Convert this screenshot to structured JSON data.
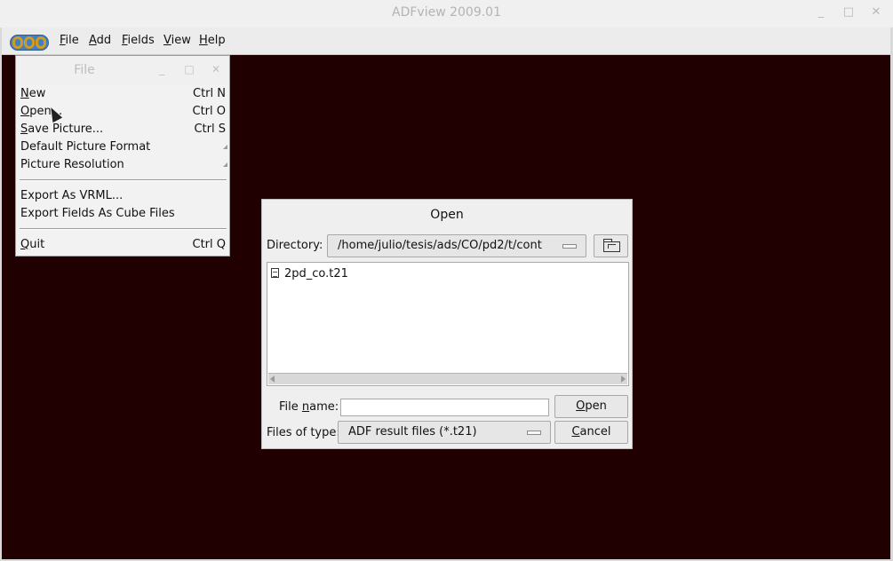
{
  "window": {
    "title": "ADFview 2009.01",
    "controls": {
      "minimize": "_",
      "maximize": "□",
      "close": "✕"
    }
  },
  "menubar": {
    "logo": "sch-logo",
    "items": [
      {
        "label": "File",
        "mnemonic": "F",
        "rest": "ile"
      },
      {
        "label": "Add",
        "mnemonic": "A",
        "rest": "dd"
      },
      {
        "label": "Fields",
        "mnemonic": "F",
        "rest": "ields"
      },
      {
        "label": "View",
        "mnemonic": "V",
        "rest": "iew"
      },
      {
        "label": "Help",
        "mnemonic": "H",
        "rest": "elp"
      }
    ]
  },
  "file_menu": {
    "title": "File",
    "items": [
      {
        "label": "New",
        "mn": "N",
        "rest": "ew",
        "accel": "Ctrl N"
      },
      {
        "label": "Open...",
        "mn": "O",
        "rest": "pen...",
        "accel": "Ctrl O"
      },
      {
        "label": "Save Picture...",
        "mn": "S",
        "rest": "ave Picture...",
        "accel": "Ctrl S"
      },
      {
        "label": "Default Picture Format",
        "submenu": true
      },
      {
        "label": "Picture Resolution",
        "submenu": true
      },
      {
        "label": "Export As VRML..."
      },
      {
        "label": "Export Fields As Cube Files"
      },
      {
        "label": "Quit",
        "mn": "Q",
        "rest": "uit",
        "accel": "Ctrl Q"
      }
    ]
  },
  "open_dialog": {
    "title": "Open",
    "directory_label": "Directory:",
    "directory_value": "/home/julio/tesis/ads/CO/pd2/t/cont",
    "files": [
      "2pd_co.t21"
    ],
    "file_name_label_pre": "File ",
    "file_name_label_mn": "n",
    "file_name_label_post": "ame:",
    "file_name_value": "",
    "files_of_type_label": "Files of type:",
    "files_of_type_value": "ADF result files (*.t21)",
    "open_button": {
      "mn": "O",
      "rest": "pen"
    },
    "cancel_button": {
      "mn": "C",
      "rest": "ancel"
    }
  },
  "colors": {
    "workspace": "#200000",
    "menubar": "#ececec",
    "dialog": "#efefef"
  }
}
